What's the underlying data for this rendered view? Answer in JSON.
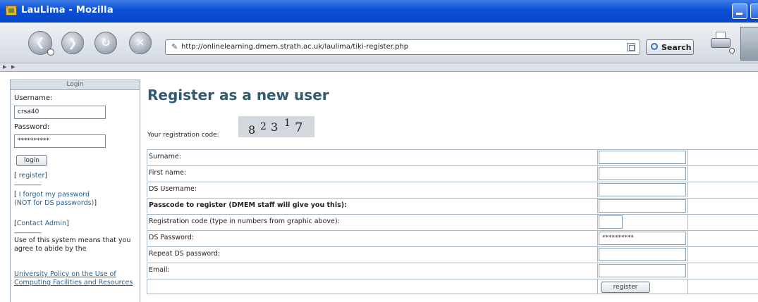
{
  "window": {
    "title": "LauLima - Mozilla"
  },
  "toolbar": {
    "back_icon": "back-arrow-icon",
    "forward_icon": "forward-arrow-icon",
    "reload_icon": "reload-icon",
    "stop_icon": "stop-icon",
    "url": "http://onlinelearning.dmem.strath.ac.uk/laulima/tiki-register.php",
    "search_label": "Search",
    "print_icon": "print-icon"
  },
  "sidebar": {
    "header": "Login",
    "username_label": "Username:",
    "username_value": "crsa40",
    "password_label": "Password:",
    "password_value": "**********",
    "login_label": "login",
    "register_open": "[ ",
    "register_link": "register",
    "register_close": "]",
    "divider": "----------------",
    "forgot_open": "[ ",
    "forgot_link_line1": "I forgot my password",
    "forgot_link_line2": "(NOT for DS passwords)",
    "forgot_close": "]",
    "contact_open": "[",
    "contact_link": "Contact Admin",
    "contact_close": "]",
    "divider2": "----------------",
    "notice": "Use of this system means that you agree to abide by the",
    "policy_link": "University Policy on the Use of Computing Facilities and Resources"
  },
  "main": {
    "title": "Register as a new user",
    "code_label": "Your registration code:",
    "captcha_digits": [
      "8",
      "2",
      "3",
      "1",
      "7"
    ],
    "form": {
      "rows": [
        {
          "label": "Surname:",
          "value": ""
        },
        {
          "label": "First name:",
          "value": ""
        },
        {
          "label": "DS Username:",
          "value": ""
        },
        {
          "label": "Passcode to register (DMEM staff will give you this):",
          "value": ""
        },
        {
          "label": "Registration code (type in numbers from graphic above):",
          "value": ""
        },
        {
          "label": "DS Password:",
          "value": "**********"
        },
        {
          "label": "Repeat DS password:",
          "value": ""
        },
        {
          "label": "Email:",
          "value": ""
        }
      ],
      "submit_label": "register"
    }
  }
}
